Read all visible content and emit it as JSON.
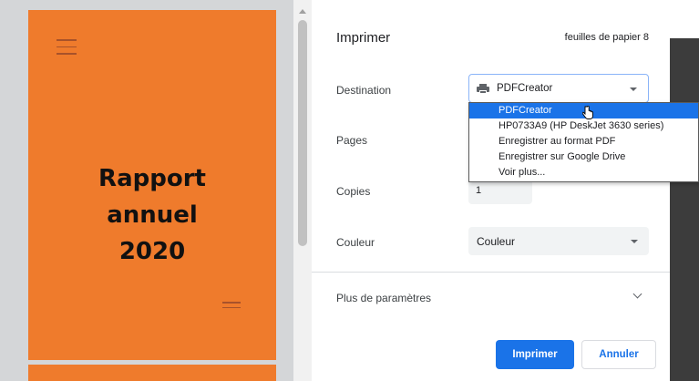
{
  "preview": {
    "title_lines": [
      "Rapport",
      "annuel",
      "2020"
    ]
  },
  "panel": {
    "title": "Imprimer",
    "sheets": "feuilles de papier 8",
    "destination": {
      "label": "Destination",
      "value": "PDFCreator",
      "icon": "printer-icon",
      "options": [
        "PDFCreator",
        "HP0733A9 (HP DeskJet 3630 series)",
        "Enregistrer au format PDF",
        "Enregistrer sur Google Drive",
        "Voir plus..."
      ],
      "highlighted_index": 0
    },
    "pages": {
      "label": "Pages"
    },
    "copies": {
      "label": "Copies",
      "value": "1"
    },
    "color": {
      "label": "Couleur",
      "value": "Couleur"
    },
    "more_settings": "Plus de paramètres",
    "print_label": "Imprimer",
    "cancel_label": "Annuler"
  },
  "colors": {
    "page": "#ef7b2c",
    "accent": "#1a73e8",
    "preview_bg": "#d4d6d8"
  }
}
